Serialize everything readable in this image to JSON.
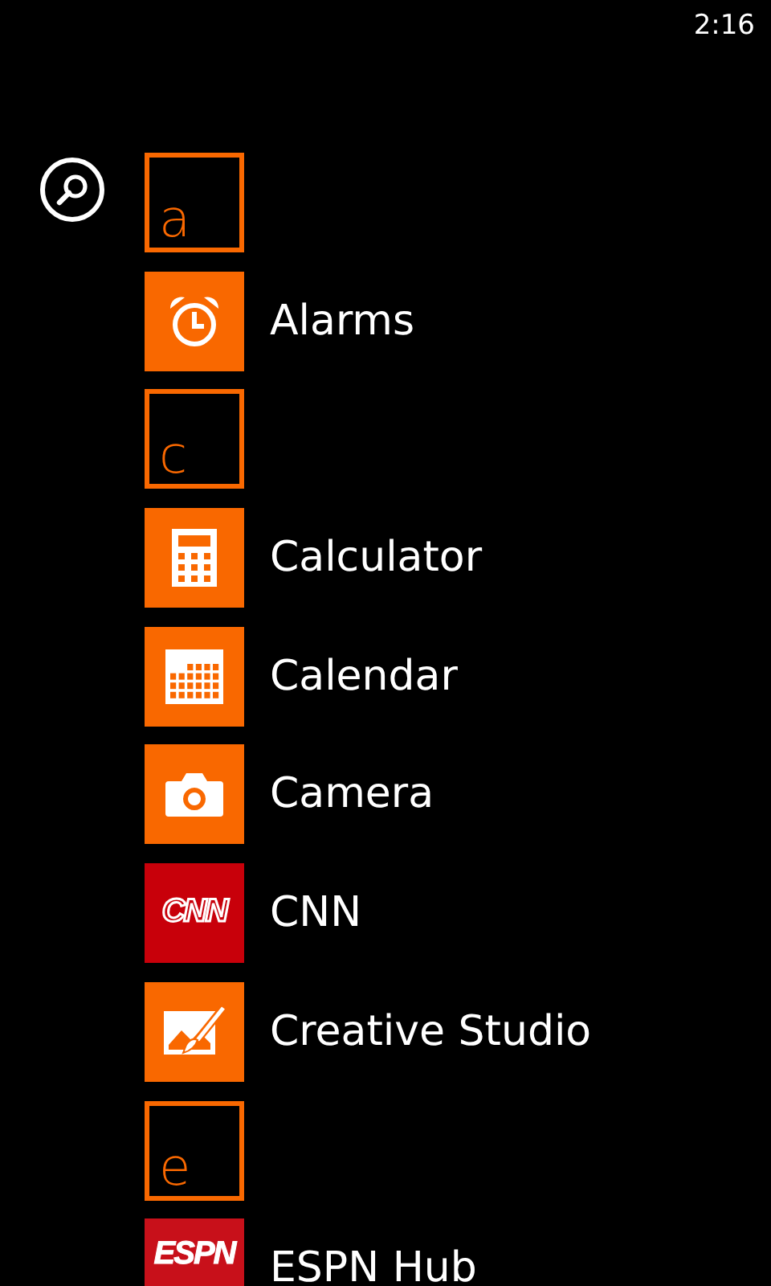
{
  "status_bar": {
    "time": "2:16"
  },
  "items": [
    {
      "kind": "header",
      "letter": "a"
    },
    {
      "kind": "alarm",
      "color": "#f96800",
      "name": "Alarms"
    },
    {
      "kind": "header",
      "letter": "c"
    },
    {
      "kind": "calculator",
      "color": "#f96800",
      "name": "Calculator"
    },
    {
      "kind": "calendar",
      "color": "#f96800",
      "name": "Calendar"
    },
    {
      "kind": "camera",
      "color": "#f96800",
      "name": "Camera"
    },
    {
      "kind": "logo",
      "color": "#c8000a",
      "name": "CNN",
      "logo_text": "CNN"
    },
    {
      "kind": "creative",
      "color": "#f96800",
      "name": "Creative Studio"
    },
    {
      "kind": "header",
      "letter": "e"
    },
    {
      "kind": "logo",
      "color": "#c8101a",
      "name": "ESPN Hub",
      "logo_text": "ESPN"
    }
  ]
}
